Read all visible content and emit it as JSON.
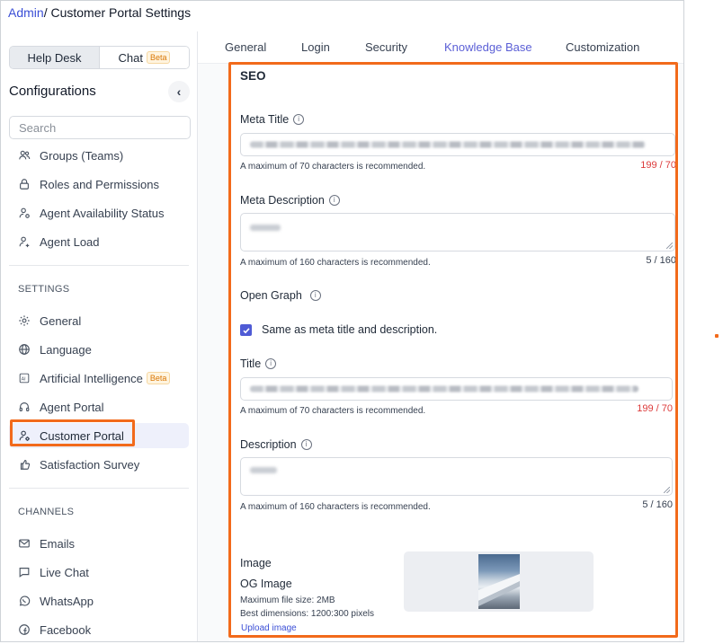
{
  "breadcrumb": {
    "root": "Admin",
    "separator": "/ ",
    "current": "Customer Portal Settings"
  },
  "sidebar": {
    "segments": {
      "helpdesk": "Help Desk",
      "chat": "Chat",
      "chat_badge": "Beta"
    },
    "title": "Configurations",
    "search_placeholder": "Search",
    "top_items": [
      {
        "label": "Groups (Teams)",
        "icon": "users-icon"
      },
      {
        "label": "Roles and Permissions",
        "icon": "lock-icon"
      },
      {
        "label": "Agent Availability Status",
        "icon": "user-status-icon"
      },
      {
        "label": "Agent Load",
        "icon": "user-load-icon"
      }
    ],
    "settings_label": "SETTINGS",
    "settings_items": [
      {
        "label": "General",
        "icon": "gear-icon"
      },
      {
        "label": "Language",
        "icon": "globe-icon"
      },
      {
        "label": "Artificial Intelligence",
        "icon": "ai-icon",
        "badge": "Beta"
      },
      {
        "label": "Agent Portal",
        "icon": "headset-icon"
      },
      {
        "label": "Customer Portal",
        "icon": "user-gear-icon",
        "active": true
      },
      {
        "label": "Satisfaction Survey",
        "icon": "survey-icon"
      }
    ],
    "channels_label": "CHANNELS",
    "channel_items": [
      {
        "label": "Emails",
        "icon": "mail-icon"
      },
      {
        "label": "Live Chat",
        "icon": "chat-icon"
      },
      {
        "label": "WhatsApp",
        "icon": "whatsapp-icon"
      },
      {
        "label": "Facebook",
        "icon": "facebook-icon"
      }
    ]
  },
  "tabs": [
    "General",
    "Login",
    "Security",
    "Knowledge Base",
    "Customization"
  ],
  "active_tab": "Knowledge Base",
  "seo": {
    "heading": "SEO",
    "meta_title": {
      "label": "Meta Title",
      "hint": "A maximum of 70 characters is recommended.",
      "counter": "199 / 70"
    },
    "meta_description": {
      "label": "Meta Description",
      "hint": "A maximum of 160 characters is recommended.",
      "counter": "5 / 160"
    },
    "open_graph": {
      "label": "Open Graph",
      "same_as_label": "Same as meta title and description."
    },
    "og_title": {
      "label": "Title",
      "hint": "A maximum of 70 characters is recommended.",
      "counter": "199 / 70"
    },
    "og_description": {
      "label": "Description",
      "hint": "A maximum of 160 characters is recommended.",
      "counter": "5 / 160"
    },
    "image": {
      "label": "Image",
      "og_label": "OG Image",
      "max_size": "Maximum file size: 2MB",
      "dimensions": "Best dimensions: 1200:300 pixels",
      "upload": "Upload image"
    }
  },
  "colors": {
    "accent": "#4f5bd5",
    "highlight": "#f26a1b",
    "error": "#dc3b3b",
    "link": "#3b4fd6"
  }
}
